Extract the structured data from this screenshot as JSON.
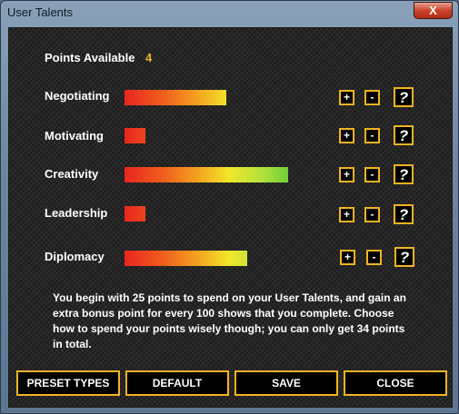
{
  "window": {
    "title": "User Talents",
    "close_label": "X"
  },
  "points": {
    "label": "Points Available",
    "value": "4"
  },
  "talents": [
    {
      "label": "Negotiating",
      "level": 0.62
    },
    {
      "label": "Motivating",
      "level": 0.13
    },
    {
      "label": "Creativity",
      "level": 1.0
    },
    {
      "label": "Leadership",
      "level": 0.13
    },
    {
      "label": "Diplomacy",
      "level": 0.75
    }
  ],
  "controls": {
    "plus_label": "+",
    "minus_label": "-",
    "help_label": "?"
  },
  "description": "You begin with 25 points to spend on your User Talents, and gain an extra bonus point for every 100 shows that you complete. Choose how to spend your points wisely though; you can only get 34 points in total.",
  "buttons": {
    "preset": "PRESET TYPES",
    "default": "DEFAULT",
    "save": "SAVE",
    "close": "CLOSE"
  },
  "colors": {
    "accent": "#f4b323",
    "bar_start": "#e8261e",
    "bar_mid": "#f1e62a",
    "bar_end": "#6fcf3a"
  }
}
